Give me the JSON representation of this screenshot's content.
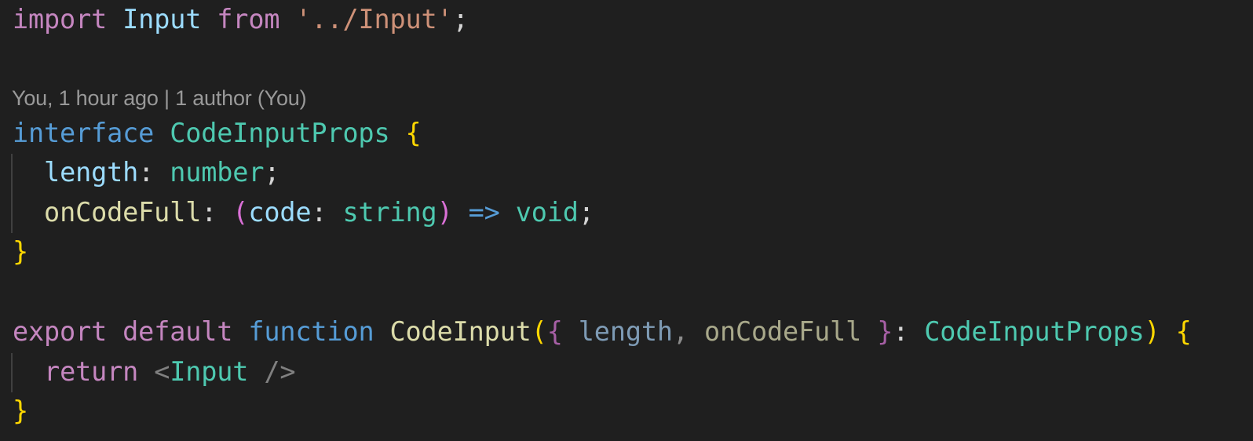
{
  "editor": {
    "background": "#1f1f1f",
    "blame": {
      "text": "You, 1 hour ago | 1 author (You)"
    },
    "lines": {
      "l1": {
        "import": "import",
        "name": "Input",
        "from": "from",
        "path": "'../Input'",
        "semi": ";"
      },
      "l3": {
        "keyword": "interface",
        "name": "CodeInputProps",
        "brace_open": "{"
      },
      "l4": {
        "prop": "length",
        "colon": ":",
        "type": "number",
        "semi": ";"
      },
      "l5": {
        "prop": "onCodeFull",
        "colon": ":",
        "paren_open": "(",
        "param": "code",
        "param_colon": ":",
        "param_type": "string",
        "paren_close": ")",
        "arrow": "=>",
        "return_type": "void",
        "semi": ";"
      },
      "l6": {
        "brace_close": "}"
      },
      "l8": {
        "export": "export",
        "default": "default",
        "function": "function",
        "name": "CodeInput",
        "paren_open": "(",
        "destructure_open": "{",
        "param1": "length",
        "comma": ",",
        "param2": "onCodeFull",
        "destructure_close": "}",
        "colon": ":",
        "type": "CodeInputProps",
        "paren_close": ")",
        "brace_open": "{"
      },
      "l9": {
        "return": "return",
        "tag_open": "<",
        "component": "Input",
        "tag_close": "/>"
      },
      "l10": {
        "brace_close": "}"
      }
    }
  }
}
